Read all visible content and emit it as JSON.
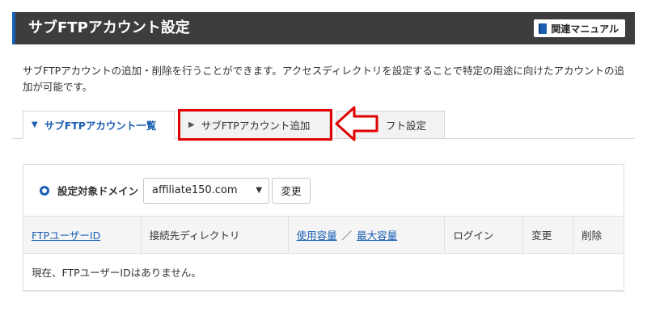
{
  "header": {
    "title": "サブFTPアカウント設定",
    "manual_label": "関連マニュアル"
  },
  "description": "サブFTPアカウントの追加・削除を行うことができます。アクセスディレクトリを設定することで特定の用途に向けたアカウントの追加が可能です。",
  "tabs": [
    {
      "label": "サブFTPアカウント一覧",
      "active": true
    },
    {
      "label": "サブFTPアカウント追加",
      "active": false
    },
    {
      "label": "フト設定",
      "active": false
    }
  ],
  "domain": {
    "label": "設定対象ドメイン",
    "selected": "affiliate150.com",
    "change_label": "変更"
  },
  "table": {
    "headers": {
      "id": "FTPユーザーID",
      "dir": "接続先ディレクトリ",
      "used": "使用容量",
      "separator": "／",
      "max": "最大容量",
      "login": "ログイン",
      "edit": "変更",
      "delete": "削除"
    },
    "empty_message": "現在、FTPユーザーIDはありません。"
  },
  "colors": {
    "accent": "#1a5fb4",
    "header_bg": "#3d3d3d",
    "highlight": "#e00000"
  }
}
